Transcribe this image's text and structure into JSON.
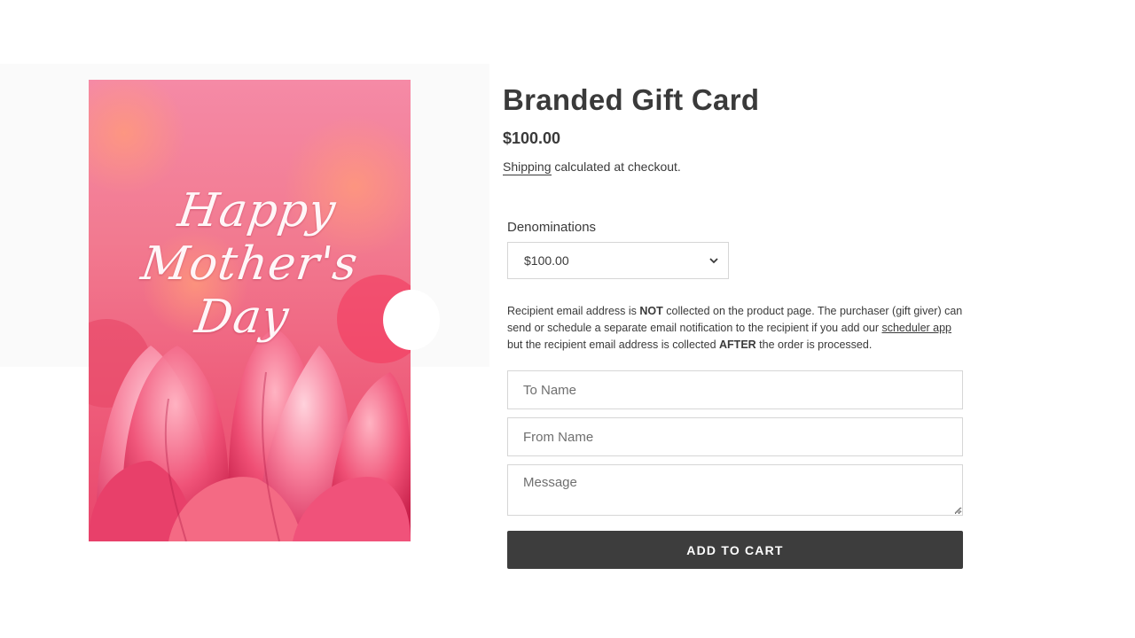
{
  "product": {
    "title": "Branded Gift Card",
    "price": "$100.00",
    "shipping_link": "Shipping",
    "shipping_rest": " calculated at checkout.",
    "image": {
      "line1": "Happy",
      "line2": "Mother's",
      "line3": "Day"
    }
  },
  "denominations": {
    "label": "Denominations",
    "selected": "$100.00"
  },
  "notice": {
    "part1": "Recipient email address is ",
    "bold1": "NOT",
    "part2": " collected on the product page. The purchaser (gift giver) can send or schedule a separate email notification to the recipient if you add our ",
    "link": "scheduler app",
    "part3": " but the recipient email address is collected ",
    "bold2": "AFTER",
    "part4": " the order is processed."
  },
  "form": {
    "to_placeholder": "To Name",
    "from_placeholder": "From Name",
    "message_placeholder": "Message",
    "add_to_cart": "ADD TO CART"
  },
  "colors": {
    "text": "#3a3a3a",
    "button_bg": "#3d3d3d",
    "button_text": "#ffffff",
    "border": "#d6d6d6"
  },
  "icons": {
    "select_arrow": "chevron-down-icon",
    "textarea_resize": "resize-grip-icon"
  }
}
